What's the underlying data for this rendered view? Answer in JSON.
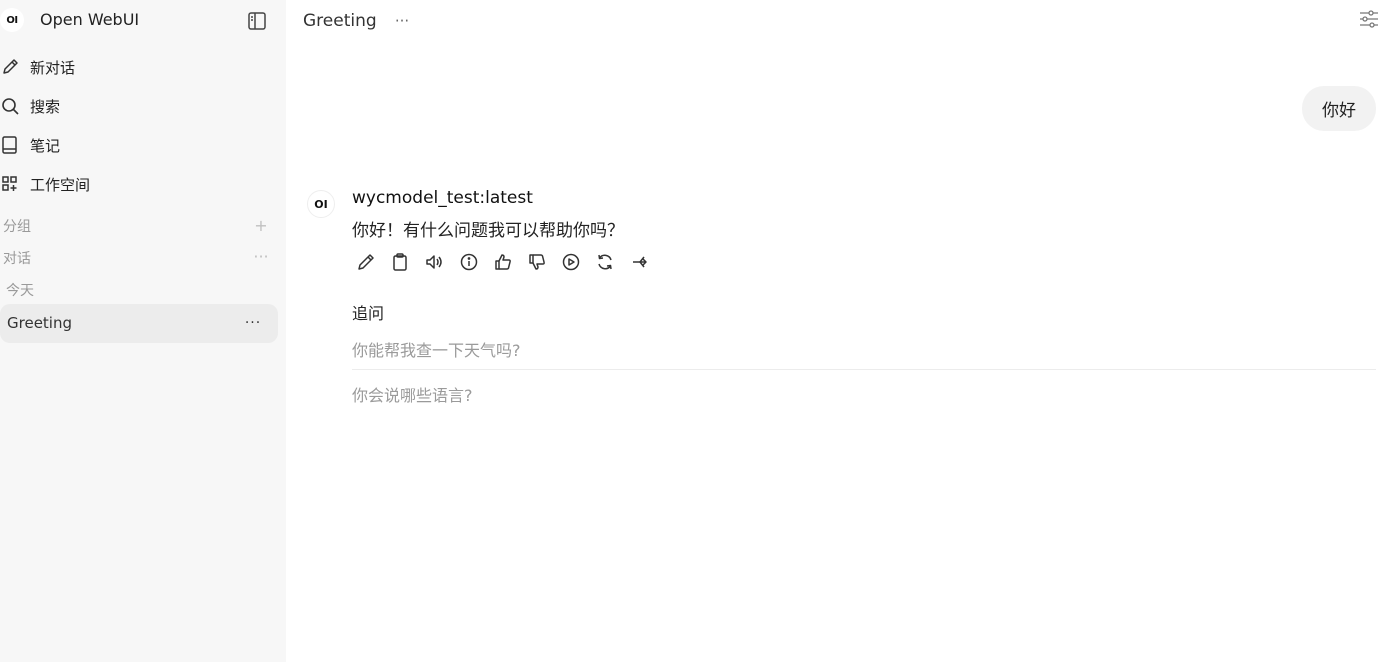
{
  "app": {
    "logo_text": "OI",
    "name": "Open WebUI"
  },
  "sidebar": {
    "nav": [
      {
        "label": "新对话",
        "icon": "pencil-icon"
      },
      {
        "label": "搜索",
        "icon": "search-icon"
      },
      {
        "label": "笔记",
        "icon": "notebook-icon"
      },
      {
        "label": "工作空间",
        "icon": "grid-plus-icon"
      }
    ],
    "groups_label": "分组",
    "groups_action": "+",
    "chats_label": "对话",
    "chats_action": "···",
    "today_label": "今天",
    "chats": [
      {
        "label": "Greeting",
        "more": "···"
      }
    ]
  },
  "header": {
    "title": "Greeting",
    "more": "···"
  },
  "conversation": {
    "user_message": "你好",
    "assistant": {
      "avatar_text": "OI",
      "model": "wycmodel_test:latest",
      "message": "你好！有什么问题我可以帮助你吗？",
      "actions": [
        "edit-icon",
        "copy-icon",
        "read-aloud-icon",
        "info-icon",
        "thumbs-up-icon",
        "thumbs-down-icon",
        "continue-icon",
        "regenerate-icon",
        "branch-icon"
      ]
    },
    "followups": {
      "title": "追问",
      "items": [
        "你能帮我查一下天气吗?",
        "你会说哪些语言?"
      ]
    }
  }
}
